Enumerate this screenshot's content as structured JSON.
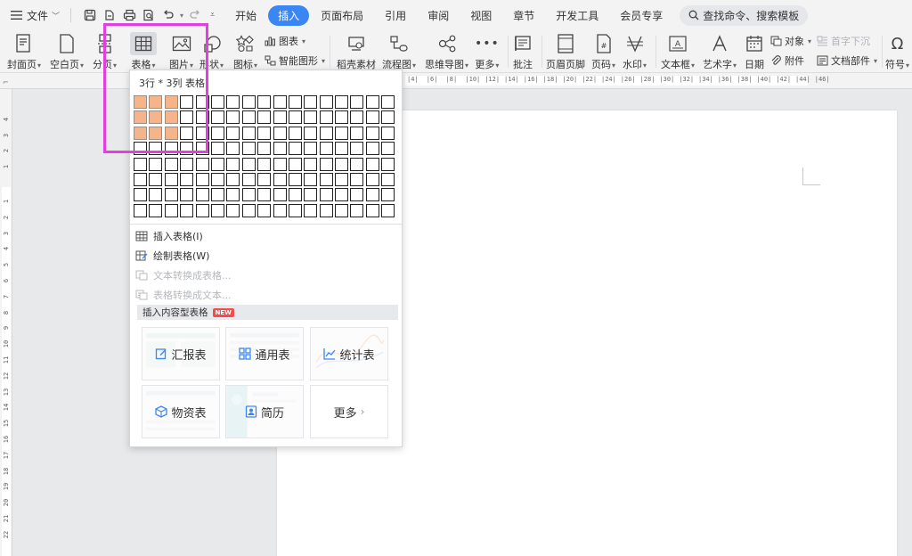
{
  "menubar": {
    "file_label": "文件",
    "tabs": [
      {
        "label": "开始",
        "active": false
      },
      {
        "label": "插入",
        "active": true
      },
      {
        "label": "页面布局",
        "active": false
      },
      {
        "label": "引用",
        "active": false
      },
      {
        "label": "审阅",
        "active": false
      },
      {
        "label": "视图",
        "active": false
      },
      {
        "label": "章节",
        "active": false
      },
      {
        "label": "开发工具",
        "active": false
      },
      {
        "label": "会员专享",
        "active": false
      }
    ],
    "search_label": "查找命令、搜索模板"
  },
  "ribbon": {
    "cover": "封面页",
    "blank": "空白页",
    "section": "分页",
    "table": "表格",
    "picture": "图片",
    "shape": "形状",
    "icon": "图标",
    "chart": "图表",
    "smartart": "智能图形",
    "daoke": "稻壳素材",
    "flow": "流程图",
    "mindmap": "思维导图",
    "more": "更多",
    "comment": "批注",
    "header_footer": "页眉页脚",
    "page_num": "页码",
    "watermark": "水印",
    "textbox": "文本框",
    "wordart": "艺术字",
    "date": "日期",
    "object": "对象",
    "dropcap": "首字下沉",
    "attachment": "附件",
    "doc_parts": "文档部件",
    "symbol": "符号"
  },
  "ruler": {
    "h_ticks": [
      "4",
      "6",
      "8",
      "10",
      "12",
      "14",
      "16",
      "18",
      "20",
      "22",
      "24",
      "26",
      "28",
      "30",
      "32",
      "34",
      "36",
      "38",
      "40",
      "42",
      "44",
      "46"
    ],
    "v_ticks_top": [
      "4",
      "3",
      "2",
      "1"
    ],
    "v_ticks": [
      "1",
      "2",
      "3",
      "4",
      "5",
      "6",
      "7",
      "8",
      "9",
      "10",
      "11",
      "12",
      "13",
      "14",
      "15",
      "16",
      "17",
      "18",
      "19",
      "20",
      "21",
      "22"
    ]
  },
  "table_menu": {
    "grid_title": "3行 * 3列 表格",
    "grid_rows": 8,
    "grid_cols": 17,
    "selected_rows": 3,
    "selected_cols": 3,
    "items": [
      {
        "label": "插入表格(I)",
        "enabled": true,
        "icon": "table-insert-icon"
      },
      {
        "label": "绘制表格(W)",
        "enabled": true,
        "icon": "table-draw-icon"
      },
      {
        "label": "文本转换成表格...",
        "enabled": false,
        "icon": "text-to-table-icon"
      },
      {
        "label": "表格转换成文本...",
        "enabled": false,
        "icon": "table-to-text-icon"
      }
    ],
    "section_title": "插入内容型表格",
    "new_badge": "NEW",
    "cards": [
      {
        "label": "汇报表",
        "icon": "edit-icon"
      },
      {
        "label": "通用表",
        "icon": "grid-icon"
      },
      {
        "label": "统计表",
        "icon": "chart-line-icon"
      },
      {
        "label": "物资表",
        "icon": "box-icon"
      },
      {
        "label": "简历",
        "icon": "resume-icon"
      },
      {
        "label": "更多",
        "icon": "chevron-right-icon"
      }
    ]
  },
  "colors": {
    "accent": "#3a86f5",
    "highlight": "#f6b48b",
    "annotation": "#e33fe0"
  }
}
